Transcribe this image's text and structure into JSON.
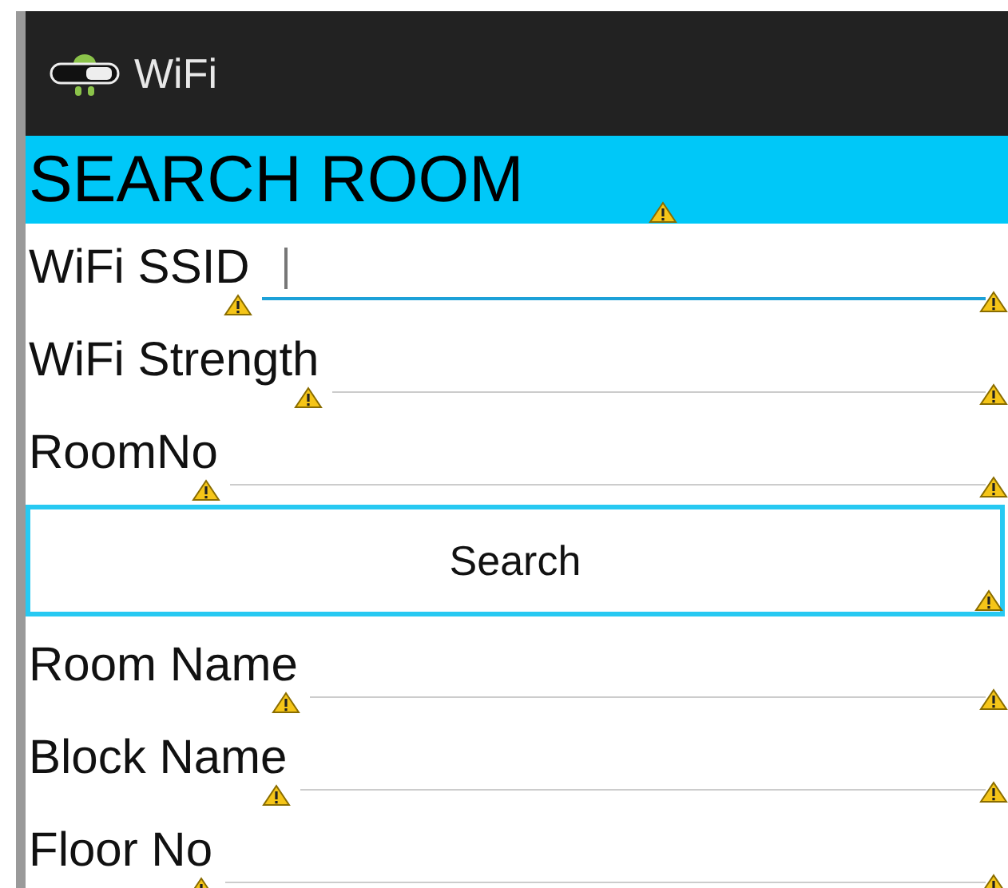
{
  "app_bar": {
    "title": "WiFi"
  },
  "header": {
    "title": "SEARCH ROOM"
  },
  "search_fields": [
    {
      "label": "WiFi SSID",
      "focused": true
    },
    {
      "label": "WiFi Strength",
      "focused": false
    },
    {
      "label": "RoomNo",
      "focused": false
    }
  ],
  "search_button": {
    "label": "Search"
  },
  "result_fields": [
    {
      "label": "Room Name",
      "focused": false
    },
    {
      "label": "Block Name",
      "focused": false
    },
    {
      "label": "Floor No",
      "focused": false
    }
  ]
}
